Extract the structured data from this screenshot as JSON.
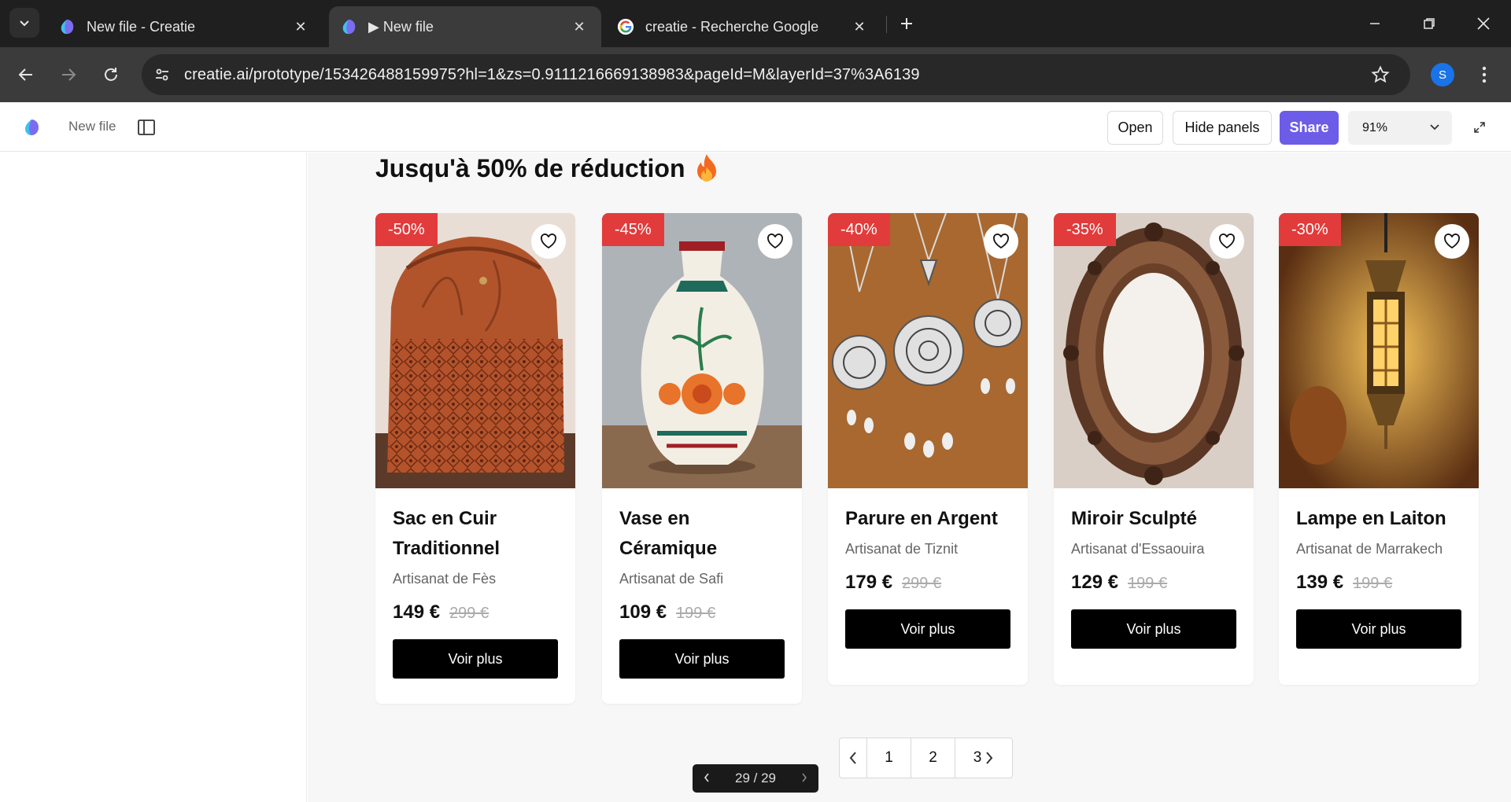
{
  "browser": {
    "tabs": [
      {
        "title": "New file - Creatie",
        "icon": "creatie-icon"
      },
      {
        "title": "▶ New file",
        "icon": "creatie-icon",
        "active": true
      },
      {
        "title": "creatie - Recherche Google",
        "icon": "google-icon"
      }
    ],
    "url": "creatie.ai/prototype/153426488159975?hl=1&zs=0.9111216669138983&pageId=M&layerId=37%3A6139",
    "profile_initial": "S"
  },
  "app": {
    "file_name": "New file",
    "open_label": "Open",
    "hide_panels_label": "Hide panels",
    "share_label": "Share",
    "zoom": "91%",
    "accent": "#6c5ce7"
  },
  "promo": {
    "heading": "Jusqu'à 50% de réduction",
    "emoji": "🔥",
    "badge_color": "#e23b3b",
    "products": [
      {
        "discount": "-50%",
        "name": "Sac en Cuir Traditionnel",
        "maker": "Artisanat de Fès",
        "price": "149 €",
        "old_price": "299 €",
        "cta": "Voir plus"
      },
      {
        "discount": "-45%",
        "name": "Vase en Céramique",
        "maker": "Artisanat de Safi",
        "price": "109 €",
        "old_price": "199 €",
        "cta": "Voir plus"
      },
      {
        "discount": "-40%",
        "name": "Parure en Argent",
        "maker": "Artisanat de Tiznit",
        "price": "179 €",
        "old_price": "299 €",
        "cta": "Voir plus"
      },
      {
        "discount": "-35%",
        "name": "Miroir Sculpté",
        "maker": "Artisanat d'Essaouira",
        "price": "129 €",
        "old_price": "199 €",
        "cta": "Voir plus"
      },
      {
        "discount": "-30%",
        "name": "Lampe en Laiton",
        "maker": "Artisanat de Marrakech",
        "price": "139 €",
        "old_price": "199 €",
        "cta": "Voir plus"
      }
    ],
    "pagination": {
      "pages": [
        "1",
        "2",
        "3"
      ]
    }
  },
  "prototype_nav": {
    "counter": "29 / 29"
  }
}
